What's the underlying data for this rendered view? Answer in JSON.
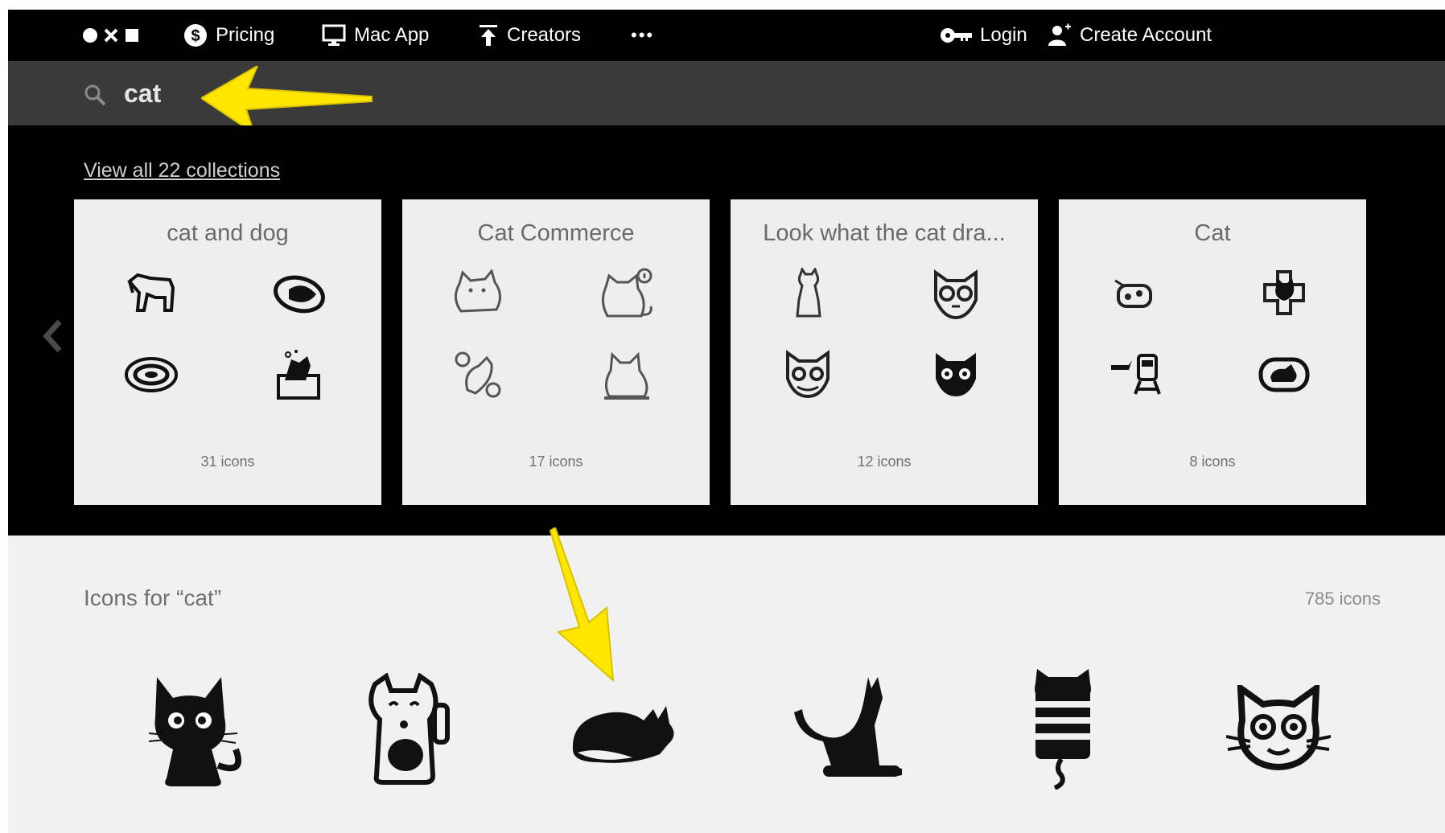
{
  "nav": {
    "pricing": "Pricing",
    "mac_app": "Mac App",
    "creators": "Creators",
    "more": "•••",
    "login": "Login",
    "create_account": "Create Account"
  },
  "search": {
    "query": "cat"
  },
  "collections": {
    "view_all": "View all 22 collections",
    "cards": [
      {
        "title": "cat and dog",
        "count": "31 icons"
      },
      {
        "title": "Cat Commerce",
        "count": "17 icons"
      },
      {
        "title": "Look what the cat dra...",
        "count": "12 icons"
      },
      {
        "title": "Cat",
        "count": "8 icons"
      }
    ]
  },
  "results": {
    "title": "Icons for “cat”",
    "count": "785 icons"
  },
  "colors": {
    "nav_bg": "#000000",
    "search_bg": "#3a3a3a",
    "card_bg": "#eeeeee",
    "results_bg": "#f1f1f1",
    "annotation_arrow": "#ffe600"
  }
}
